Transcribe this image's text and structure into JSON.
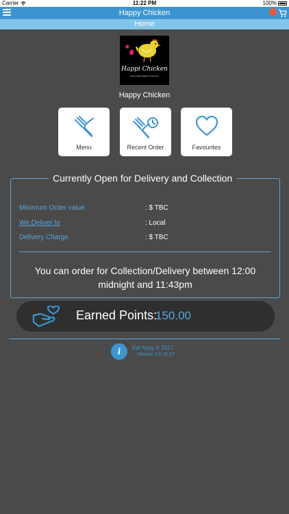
{
  "status_bar": {
    "carrier": "Carrier",
    "time": "11:22 PM",
    "battery": "100%"
  },
  "nav": {
    "title": "Happy Chicken",
    "subtitle": "Home"
  },
  "logo": {
    "name": "Happi Chicken",
    "tagline": "Home Style Meals On The Run"
  },
  "restaurant_name": "Happy Chicken",
  "tiles": [
    {
      "label": "Menu",
      "icon": "fork-knife-icon"
    },
    {
      "label": "Recent Order",
      "icon": "recent-order-icon"
    },
    {
      "label": "Favourites",
      "icon": "heart-icon"
    }
  ],
  "info": {
    "title": "Currently Open for Delivery and Collection",
    "rows": [
      {
        "key": "Minimum Order value",
        "value": ": $ TBC"
      },
      {
        "key": "We Deliver to",
        "value": ": Local"
      },
      {
        "key": "Delivery Charge",
        "value": ": $ TBC"
      }
    ],
    "order_window": "You can order for Collection/Delivery between 12:00 midnight and 11:43pm"
  },
  "points": {
    "label": "Earned Points:",
    "value": "150.00"
  },
  "footer": {
    "copyright": "Eat Appy © 2017",
    "version": "Version 3.0.10.27"
  },
  "colors": {
    "primary": "#3d95cf",
    "light_blue": "#83c5ea",
    "background": "#4a4a4b",
    "badge": "#e65a3c"
  }
}
